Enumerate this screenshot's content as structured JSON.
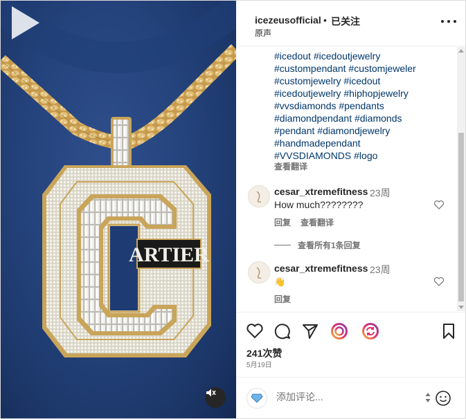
{
  "post": {
    "username": "icezeusofficial",
    "separator": "•",
    "follow_status": "已关注",
    "audio_label": "原声"
  },
  "caption": {
    "tags": [
      "#icedout",
      "#icedoutjewelry",
      "#custompendant",
      "#customjeweler",
      "#customjewelry",
      "#icedout",
      "#icedoutjewelry",
      "#hiphopjewelry",
      "#vvsdiamonds",
      "#pendants",
      "#diamondpendant",
      "#diamonds",
      "#pendant",
      "#diamondjewelry",
      "#handmadependant",
      "#VVSDIAMONDS",
      "#logo"
    ],
    "tag_lines": [
      "#icedout #icedoutjewelry",
      "#custompendant #customjeweler",
      "#customjewelry #icedout",
      "#icedoutjewelry #hiphopjewelry",
      "#vvsdiamonds #pendants",
      "#diamondpendant #diamonds",
      "#pendant #diamondjewelry",
      "#handmadependant",
      "#VVSDIAMONDS #logo"
    ],
    "see_translation": "查看翻译"
  },
  "comments": [
    {
      "user": "cesar_xtremefitness",
      "time": "23周",
      "text": "How much????????",
      "reply_label": "回复",
      "translate_label": "查看翻译"
    },
    {
      "user": "cesar_xtremefitness",
      "time": "23周",
      "text": "👋",
      "reply_label": "回复"
    }
  ],
  "view_replies": "查看所有1条回复",
  "likes": "241次赞",
  "date": "5月19日",
  "composer": {
    "placeholder": "添加评论..."
  },
  "pendant_overlay_text": "ARTIER",
  "icons": {
    "like": "heart-icon",
    "comment": "comment-icon",
    "share": "send-icon",
    "collab1": "threads-icon",
    "collab2": "refresh-icon",
    "save": "bookmark-icon",
    "more": "more-icon",
    "mute": "muted-speaker-icon",
    "play": "play-icon",
    "emoji": "emoji-icon"
  },
  "colors": {
    "link": "#00376b",
    "secondary_text": "#737373",
    "accent_gradient": [
      "#fdc830",
      "#e1306c",
      "#833ab4"
    ]
  }
}
